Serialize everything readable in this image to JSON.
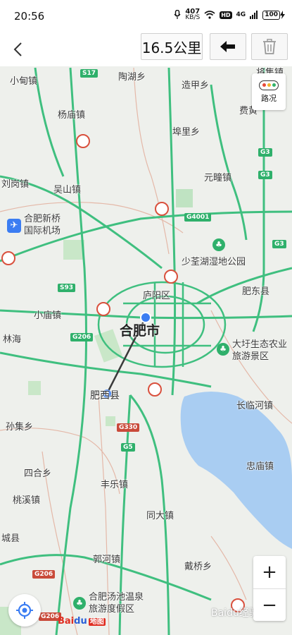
{
  "status": {
    "time": "20:56",
    "net_speed": "407",
    "net_unit": "KB/S",
    "hd": "HD",
    "signal": "4G",
    "battery": "100"
  },
  "toolbar": {
    "distance": "16.5公里"
  },
  "traffic_button": {
    "label": "路况"
  },
  "map": {
    "city_label": "合肥市",
    "places": {
      "xiaodian": "小甸镇",
      "taoliao": "陶湖乡",
      "jianglou": "将集镇",
      "zaojia": "造甲乡",
      "yangmiao": "杨庙镇",
      "feihuang": "费黄",
      "fuli": "埠里乡",
      "liugang": "刘岗镇",
      "wushan": "吴山镇",
      "yuanzhuang": "元疃镇",
      "airport": "合肥新桥国际机场",
      "shaoquan": "少荃湖湿地公园",
      "luyang": "庐阳区",
      "feidong": "肥东县",
      "xiaomiao": "小庙镇",
      "lin": "林海",
      "dawei": "大圩生态农业旅游景区",
      "feixi": "肥西县",
      "changlin": "长临河镇",
      "sunji": "孙集乡",
      "zhongmiao": "忠庙镇",
      "sihe": "四合乡",
      "fengle": "丰乐镇",
      "taoxi": "桃溪镇",
      "tongda": "同大镇",
      "cheng": "城县",
      "guohe": "郭河镇",
      "daiqiao": "戴桥乡",
      "tangquan": "合肥汤池温泉旅游度假区"
    },
    "shields": [
      "S17",
      "G3",
      "G3",
      "G4001",
      "G3",
      "S93",
      "G206",
      "G330",
      "G5",
      "G206",
      "G206"
    ]
  },
  "zoom": {
    "in": "+",
    "out": "−"
  },
  "logo": {
    "bai": "Bai",
    "du": "du",
    "ditu": "地图"
  },
  "watermark": "Baidu经验",
  "colors": {
    "road": "#3fbf7f",
    "highway": "#2fa868",
    "water": "#a9cdf2",
    "line": "#3a3a3a",
    "accent": "#3b7df2"
  }
}
